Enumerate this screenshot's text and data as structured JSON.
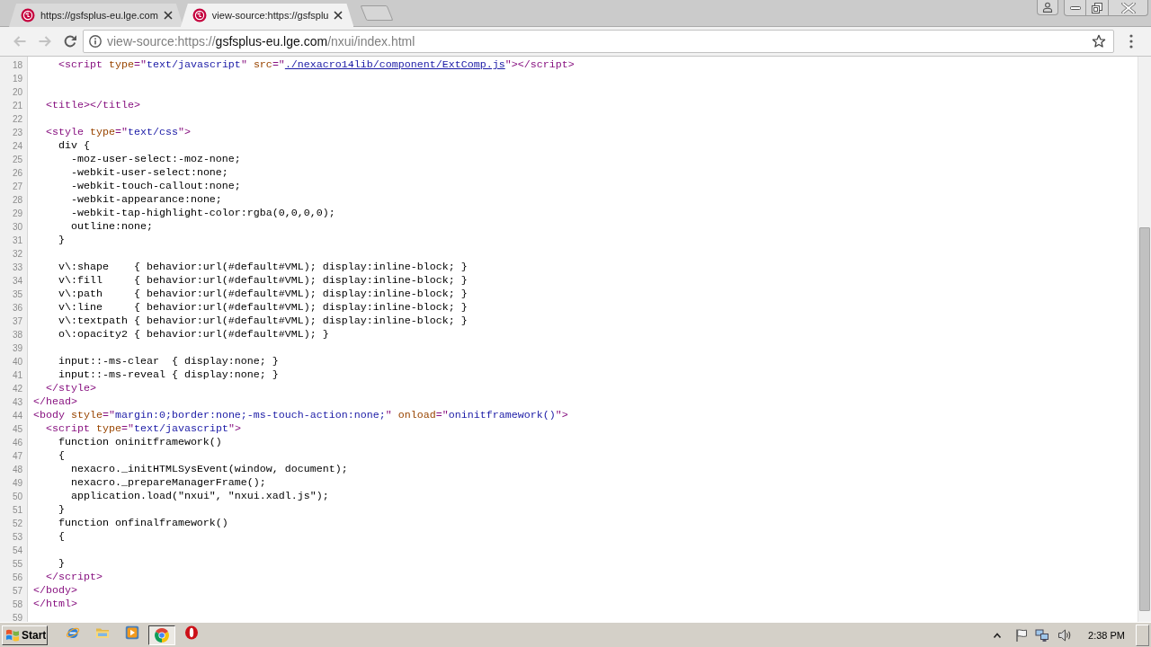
{
  "browser": {
    "tabs": [
      {
        "title": "https://gsfsplus-eu.lge.com",
        "selected": false
      },
      {
        "title": "view-source:https://gsfsplu",
        "selected": true
      }
    ],
    "nav_buttons": [
      {
        "kind": "back",
        "disabled": true
      },
      {
        "kind": "forward",
        "disabled": true
      },
      {
        "kind": "reload",
        "disabled": false
      }
    ],
    "address_bar": {
      "segments": [
        {
          "kind": "prefix",
          "text": "view-source:https://"
        },
        {
          "kind": "host",
          "text": "gsfsplus-eu.lge.com"
        },
        {
          "kind": "path",
          "text": "/nxui/index.html"
        }
      ]
    }
  },
  "source": {
    "lines": [
      {
        "number": "18",
        "tokens": [
          {
            "kind": "tag",
            "text": "    <script "
          },
          {
            "kind": "attr",
            "text": "type"
          },
          {
            "kind": "tag",
            "text": "=\""
          },
          {
            "kind": "value",
            "text": "text/javascript"
          },
          {
            "kind": "tag",
            "text": "\" "
          },
          {
            "kind": "attr",
            "text": "src"
          },
          {
            "kind": "tag",
            "text": "=\""
          },
          {
            "kind": "link",
            "text": "./nexacro14lib/component/ExtComp.js"
          },
          {
            "kind": "tag",
            "text": "\"></script>"
          }
        ]
      },
      {
        "number": "19"
      },
      {
        "number": "20"
      },
      {
        "number": "21",
        "tokens": [
          {
            "kind": "tag",
            "text": "  <title></title>"
          }
        ]
      },
      {
        "number": "22"
      },
      {
        "number": "23",
        "tokens": [
          {
            "kind": "tag",
            "text": "  <style "
          },
          {
            "kind": "attr",
            "text": "type"
          },
          {
            "kind": "tag",
            "text": "=\""
          },
          {
            "kind": "value",
            "text": "text/css"
          },
          {
            "kind": "tag",
            "text": "\">"
          }
        ]
      },
      {
        "number": "24",
        "tokens": [
          {
            "kind": "text",
            "text": "    div {"
          }
        ]
      },
      {
        "number": "25",
        "tokens": [
          {
            "kind": "text",
            "text": "      -moz-user-select:-moz-none;"
          }
        ]
      },
      {
        "number": "26",
        "tokens": [
          {
            "kind": "text",
            "text": "      -webkit-user-select:none;"
          }
        ]
      },
      {
        "number": "27",
        "tokens": [
          {
            "kind": "text",
            "text": "      -webkit-touch-callout:none;"
          }
        ]
      },
      {
        "number": "28",
        "tokens": [
          {
            "kind": "text",
            "text": "      -webkit-appearance:none;"
          }
        ]
      },
      {
        "number": "29",
        "tokens": [
          {
            "kind": "text",
            "text": "      -webkit-tap-highlight-color:rgba(0,0,0,0);"
          }
        ]
      },
      {
        "number": "30",
        "tokens": [
          {
            "kind": "text",
            "text": "      outline:none;"
          }
        ]
      },
      {
        "number": "31",
        "tokens": [
          {
            "kind": "text",
            "text": "    }"
          }
        ]
      },
      {
        "number": "32"
      },
      {
        "number": "33",
        "tokens": [
          {
            "kind": "text",
            "text": "    v\\:shape    { behavior:url(#default#VML); display:inline-block; }"
          }
        ]
      },
      {
        "number": "34",
        "tokens": [
          {
            "kind": "text",
            "text": "    v\\:fill     { behavior:url(#default#VML); display:inline-block; }"
          }
        ]
      },
      {
        "number": "35",
        "tokens": [
          {
            "kind": "text",
            "text": "    v\\:path     { behavior:url(#default#VML); display:inline-block; }"
          }
        ]
      },
      {
        "number": "36",
        "tokens": [
          {
            "kind": "text",
            "text": "    v\\:line     { behavior:url(#default#VML); display:inline-block; }"
          }
        ]
      },
      {
        "number": "37",
        "tokens": [
          {
            "kind": "text",
            "text": "    v\\:textpath { behavior:url(#default#VML); display:inline-block; }"
          }
        ]
      },
      {
        "number": "38",
        "tokens": [
          {
            "kind": "text",
            "text": "    o\\:opacity2 { behavior:url(#default#VML); }"
          }
        ]
      },
      {
        "number": "39"
      },
      {
        "number": "40",
        "tokens": [
          {
            "kind": "text",
            "text": "    input::-ms-clear  { display:none; }"
          }
        ]
      },
      {
        "number": "41",
        "tokens": [
          {
            "kind": "text",
            "text": "    input::-ms-reveal { display:none; }"
          }
        ]
      },
      {
        "number": "42",
        "tokens": [
          {
            "kind": "tag",
            "text": "  </style>"
          }
        ]
      },
      {
        "number": "43",
        "tokens": [
          {
            "kind": "tag",
            "text": "</head>"
          }
        ]
      },
      {
        "number": "44",
        "tokens": [
          {
            "kind": "tag",
            "text": "<body "
          },
          {
            "kind": "attr",
            "text": "style"
          },
          {
            "kind": "tag",
            "text": "=\""
          },
          {
            "kind": "value",
            "text": "margin:0;border:none;-ms-touch-action:none;"
          },
          {
            "kind": "tag",
            "text": "\" "
          },
          {
            "kind": "attr",
            "text": "onload"
          },
          {
            "kind": "tag",
            "text": "=\""
          },
          {
            "kind": "value",
            "text": "oninitframework()"
          },
          {
            "kind": "tag",
            "text": "\">"
          }
        ]
      },
      {
        "number": "45",
        "tokens": [
          {
            "kind": "tag",
            "text": "  <script "
          },
          {
            "kind": "attr",
            "text": "type"
          },
          {
            "kind": "tag",
            "text": "=\""
          },
          {
            "kind": "value",
            "text": "text/javascript"
          },
          {
            "kind": "tag",
            "text": "\">"
          }
        ]
      },
      {
        "number": "46",
        "tokens": [
          {
            "kind": "text",
            "text": "    function oninitframework()"
          }
        ]
      },
      {
        "number": "47",
        "tokens": [
          {
            "kind": "text",
            "text": "    {"
          }
        ]
      },
      {
        "number": "48",
        "tokens": [
          {
            "kind": "text",
            "text": "      nexacro._initHTMLSysEvent(window, document);"
          }
        ]
      },
      {
        "number": "49",
        "tokens": [
          {
            "kind": "text",
            "text": "      nexacro._prepareManagerFrame();"
          }
        ]
      },
      {
        "number": "50",
        "tokens": [
          {
            "kind": "text",
            "text": "      application.load(\"nxui\", \"nxui.xadl.js\");"
          }
        ]
      },
      {
        "number": "51",
        "tokens": [
          {
            "kind": "text",
            "text": "    }"
          }
        ]
      },
      {
        "number": "52",
        "tokens": [
          {
            "kind": "text",
            "text": "    function onfinalframework()"
          }
        ]
      },
      {
        "number": "53",
        "tokens": [
          {
            "kind": "text",
            "text": "    {"
          }
        ]
      },
      {
        "number": "54"
      },
      {
        "number": "55",
        "tokens": [
          {
            "kind": "text",
            "text": "    }"
          }
        ]
      },
      {
        "number": "56",
        "tokens": [
          {
            "kind": "tag",
            "text": "  </script>"
          }
        ]
      },
      {
        "number": "57",
        "tokens": [
          {
            "kind": "tag",
            "text": "</body>"
          }
        ]
      },
      {
        "number": "58",
        "tokens": [
          {
            "kind": "tag",
            "text": "</html>"
          }
        ]
      },
      {
        "number": "59"
      }
    ]
  },
  "taskbar": {
    "start_label": "Start",
    "apps": [
      {
        "kind": "globe",
        "selected": false
      },
      {
        "kind": "folder",
        "selected": false
      },
      {
        "kind": "player",
        "selected": false
      },
      {
        "kind": "browser",
        "selected": true
      },
      {
        "kind": "ring",
        "selected": false
      }
    ],
    "clock": "2:38 PM"
  }
}
